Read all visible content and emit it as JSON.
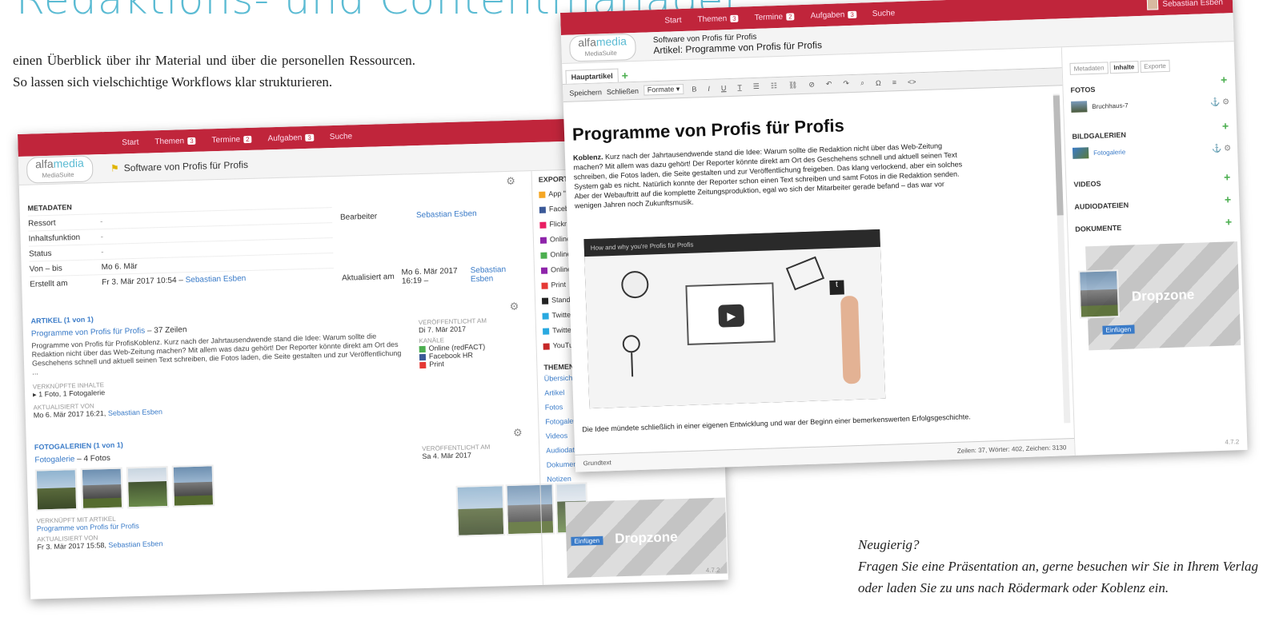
{
  "heading": "r Redaktions- und Contentmanager",
  "intro": "einen Überblick über ihr Material und über die personellen Ressourcen. So lassen sich vielschichtige Workflows klar strukturieren.",
  "outro": {
    "line1": "Neugierig?",
    "line2": "Fragen Sie eine Präsentation an, gerne besuchen wir Sie in Ihrem Verlag oder laden Sie zu uns nach Rödermark oder Koblenz ein."
  },
  "colors": {
    "accent": "#c0253b",
    "brand": "#5bbbd3"
  },
  "nav": {
    "items": [
      {
        "label": "Start",
        "count": ""
      },
      {
        "label": "Themen",
        "count": "3"
      },
      {
        "label": "Termine",
        "count": "2"
      },
      {
        "label": "Aufgaben",
        "count": "3"
      },
      {
        "label": "Suche",
        "count": ""
      }
    ],
    "user": "Sebastian Esben"
  },
  "logo": {
    "brand_a": "alfa",
    "brand_b": "media",
    "sub": "MediaSuite"
  },
  "shotA": {
    "title": "Software von Profis für Profis",
    "metadata": {
      "header": "METADATEN",
      "rows": [
        {
          "k": "Ressort",
          "v": "-"
        },
        {
          "k": "Inhaltsfunktion",
          "v": "-"
        },
        {
          "k": "Status",
          "v": "-"
        },
        {
          "k": "Von – bis",
          "v": "Mo 6. Mär"
        },
        {
          "k": "Erstellt am",
          "v": "Fr 3. Mär 2017 10:54 –",
          "link": "Sebastian Esben"
        }
      ],
      "bearbeiter_label": "Bearbeiter",
      "bearbeiter_value": "Sebastian Esben",
      "aktualisiert_label": "Aktualisiert am",
      "aktualisiert_value": "Mo 6. Mär 2017 16:19 –",
      "aktualisiert_link": "Sebastian Esben"
    },
    "artikel": {
      "header": "ARTIKEL (1 von 1)",
      "title": "Programme von Profis für Profis",
      "meta": "– 37 Zeilen",
      "text": "Programme von Profis für ProfisKoblenz. Kurz nach der Jahrtausendwende stand die Idee: Warum sollte die Redaktion nicht über das Web-Zeitung machen? Mit allem was dazu gehört! Der Reporter könnte direkt am Ort des Geschehens schnell und aktuell seinen Text schreiben, die Fotos laden, die Seite gestalten und zur Veröffentlichung ...",
      "assets_label": "VERKNÜPFTE INHALTE",
      "assets": "1 Foto, 1 Fotogalerie",
      "updated_label": "AKTUALISIERT VON",
      "updated": "Mo 6. Mär 2017 16:21,",
      "updated_user": "Sebastian Esben",
      "published_label": "VERÖFFENTLICHT AM",
      "published": "Di 7. Mär 2017",
      "channels_label": "KANÄLE",
      "channels": [
        {
          "name": "Online (redFACT)",
          "color": "#4caf50"
        },
        {
          "name": "Facebook HR",
          "color": "#3b5998"
        },
        {
          "name": "Print",
          "color": "#e53935"
        }
      ]
    },
    "fotogalerien": {
      "header": "FOTOGALERIEN (1 von 1)",
      "title": "Fotogalerie",
      "meta": "– 4 Fotos",
      "linked_label": "VERKNÜPFT MIT ARTIKEL",
      "linked": "Programme von Profis für Profis",
      "updated_label": "AKTUALISIERT VON",
      "updated": "Fr 3. Mär 2017 15:58,",
      "updated_user": "Sebastian Esben",
      "published_label": "VERÖFFENTLICHT AM",
      "published": "Sa 4. Mär 2017"
    },
    "exporte": {
      "header": "EXPORTE",
      "items": [
        {
          "name": "App \"St",
          "color": "#f5a623"
        },
        {
          "name": "Facebo",
          "color": "#3b5998"
        },
        {
          "name": "Flickr",
          "color": "#e91e63"
        },
        {
          "name": "Online",
          "color": "#8e24aa"
        },
        {
          "name": "Online",
          "color": "#4caf50"
        },
        {
          "name": "Online",
          "color": "#8e24aa"
        },
        {
          "name": "Print",
          "color": "#e53935"
        },
        {
          "name": "Standar",
          "color": "#222222"
        },
        {
          "name": "Twitter",
          "color": "#29a9e0"
        },
        {
          "name": "Twitter",
          "color": "#29a9e0"
        },
        {
          "name": "YouTub",
          "color": "#c62828"
        }
      ]
    },
    "themen": {
      "header": "THEMENIN",
      "items": [
        "Übersicht",
        "Artikel",
        "Fotos",
        "Fotogalerie",
        "Videos",
        "Audiodateien",
        "Dokumente",
        "Notizen"
      ]
    },
    "dropzone": "Dropzone",
    "drop_btn": "Einfügen",
    "version": "4.7.2"
  },
  "shotB": {
    "breadcrumb1": "Software von Profis für Profis",
    "breadcrumb2": "Artikel: Programme von Profis für Profis",
    "tab": "Hauptartikel",
    "toolbar": {
      "save": "Speichern",
      "close": "Schließen",
      "format": "Formate ▾"
    },
    "article": {
      "title": "Programme von Profis für Profis",
      "lead": "Koblenz.",
      "body": "Kurz nach der Jahrtausendwende stand die Idee: Warum sollte die Redaktion nicht über das Web-Zeitung machen? Mit allem was dazu gehört! Der Reporter könnte direkt am Ort des Geschehens schnell und aktuell seinen Text schreiben, die Fotos laden, die Seite gestalten und zur Veröffentlichung freigeben. Das klang verlockend, aber ein solches System gab es nicht. Natürlich konnte der Reporter schon einen Text schreiben und samt Fotos in die Redaktion senden. Aber der Webauftritt auf die komplette Zeitungsproduktion, egal wo sich der Mitarbeiter gerade befand – das war vor wenigen Jahren noch Zukunftsmusik.",
      "video_caption": "How and why you're Profis für Profis",
      "footer_text": "Die Idee mündete schließlich in einer eigenen Entwicklung und war der Beginn einer bemerkenswerten Erfolgsgeschichte."
    },
    "status_left": "Grundtext",
    "status_right": "Zeilen: 37, Wörter: 402, Zeichen: 3130",
    "side_tabs": [
      "Metadaten",
      "Inhalte",
      "Exporte"
    ],
    "sections": [
      {
        "title": "FOTOS",
        "item": "Bruchhaus-7"
      },
      {
        "title": "BILDGALERIEN",
        "item": "Fotogalerie"
      },
      {
        "title": "VIDEOS",
        "item": ""
      },
      {
        "title": "AUDIODATEIEN",
        "item": ""
      },
      {
        "title": "DOKUMENTE",
        "item": ""
      }
    ],
    "dropzone": "Dropzone",
    "drop_btn": "Einfügen",
    "version": "4.7.2"
  }
}
